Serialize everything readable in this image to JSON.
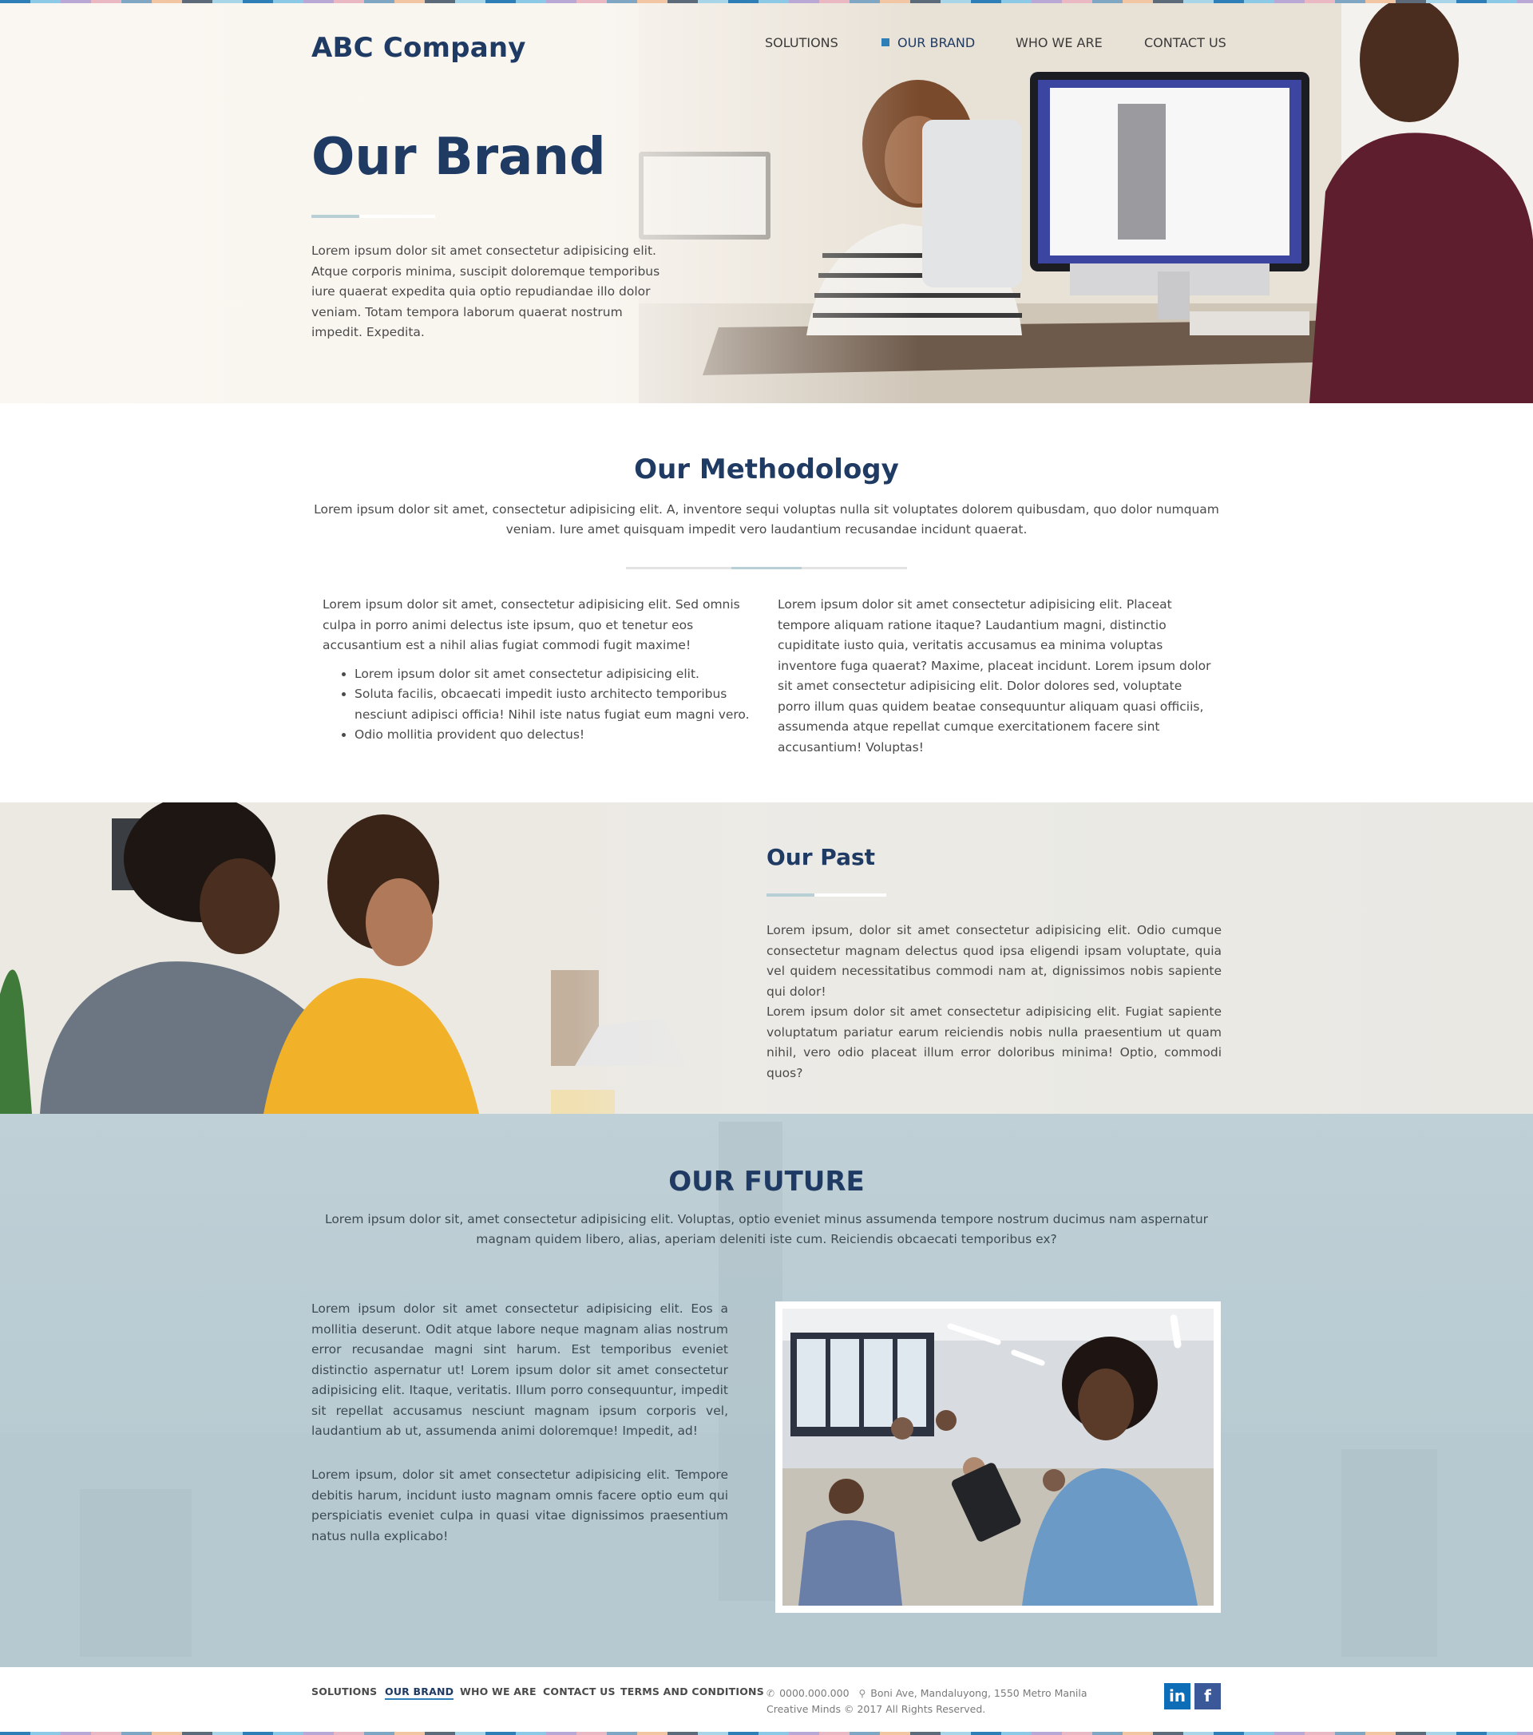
{
  "header": {
    "logo": "ABC Company",
    "nav": [
      "SOLUTIONS",
      "OUR BRAND",
      "WHO WE ARE",
      "CONTACT US"
    ]
  },
  "hero": {
    "title": "Our Brand",
    "text": "Lorem ipsum dolor sit amet consectetur adipisicing elit. Atque corporis minima, suscipit doloremque temporibus iure quaerat expedita quia optio repudiandae illo dolor veniam. Totam tempora laborum quaerat nostrum impedit. Expedita."
  },
  "methodology": {
    "title": "Our Methodology",
    "intro": "Lorem ipsum dolor sit amet, consectetur adipisicing elit. A, inventore sequi voluptas nulla sit voluptates dolorem quibusdam, quo dolor numquam veniam. Iure amet quisquam impedit vero laudantium recusandae incidunt quaerat.",
    "left_text": "Lorem ipsum dolor sit amet, consectetur adipisicing elit. Sed omnis culpa in porro animi delectus iste ipsum, quo et tenetur eos accusantium est a nihil alias fugiat commodi fugit maxime!",
    "bullets": [
      "Lorem ipsum dolor sit amet consectetur adipisicing elit.",
      "Soluta facilis, obcaecati impedit iusto architecto temporibus nesciunt adipisci officia! Nihil iste natus fugiat eum magni vero.",
      "Odio mollitia provident quo delectus!"
    ],
    "right_text": "Lorem ipsum dolor sit amet consectetur adipisicing elit. Placeat tempore aliquam ratione itaque? Laudantium magni, distinctio cupiditate iusto quia, veritatis accusamus ea minima voluptas inventore fuga quaerat? Maxime, placeat incidunt. Lorem ipsum dolor sit amet consectetur adipisicing elit. Dolor dolores sed, voluptate porro illum quas quidem beatae consequuntur aliquam quasi officiis, assumenda atque repellat cumque exercitationem facere sint accusantium! Voluptas!"
  },
  "past": {
    "title": "Our Past",
    "p1": "Lorem ipsum, dolor sit amet consectetur adipisicing elit. Odio cumque consectetur magnam delectus quod ipsa eligendi ipsam voluptate, quia vel quidem necessitatibus commodi nam at, dignissimos nobis sapiente qui dolor!",
    "p2": "Lorem ipsum dolor sit amet consectetur adipisicing elit. Fugiat sapiente voluptatum pariatur earum reiciendis nobis nulla praesentium ut quam nihil, vero odio placeat illum error doloribus minima! Optio, commodi quos?"
  },
  "future": {
    "title": "OUR FUTURE",
    "intro": "Lorem ipsum dolor sit, amet consectetur adipisicing elit. Voluptas, optio eveniet minus assumenda tempore nostrum ducimus nam aspernatur magnam quidem libero, alias, aperiam deleniti iste cum. Reiciendis obcaecati temporibus ex?",
    "p1": "Lorem ipsum dolor sit amet consectetur adipisicing elit. Eos a mollitia deserunt. Odit atque labore neque magnam alias nostrum error recusandae magni sint harum. Est temporibus eveniet distinctio aspernatur ut! Lorem ipsum dolor sit amet consectetur adipisicing elit. Itaque, veritatis. Illum porro consequuntur, impedit sit repellat accusamus nesciunt magnam ipsum corporis vel, laudantium ab ut, assumenda animi doloremque! Impedit, ad!",
    "p2": "Lorem ipsum, dolor sit amet consectetur adipisicing elit. Tempore debitis harum, incidunt iusto magnam omnis facere optio eum qui perspiciatis eveniet culpa in quasi vitae dignissimos praesentium natus nulla explicabo!"
  },
  "footer": {
    "links": [
      "SOLUTIONS",
      "OUR BRAND",
      "WHO WE ARE",
      "CONTACT US",
      "TERMS AND CONDITIONS"
    ],
    "phone": "0000.000.000",
    "address": "Boni Ave, Mandaluyong, 1550 Metro Manila",
    "copyright": "Creative Minds © 2017 All Rights Reserved.",
    "social": [
      "in",
      "f"
    ]
  },
  "icons": {
    "phone": "phone-icon",
    "location": "location-pin-icon",
    "linkedin": "linkedin-icon",
    "facebook": "facebook-icon"
  },
  "colors": {
    "brand_navy": "#1f3a63",
    "accent_blue": "#2e7fb8",
    "linkedin": "#0e6db7",
    "facebook": "#3b5998",
    "future_bg": "#bccdd3",
    "past_bg": "#ecebe6"
  }
}
